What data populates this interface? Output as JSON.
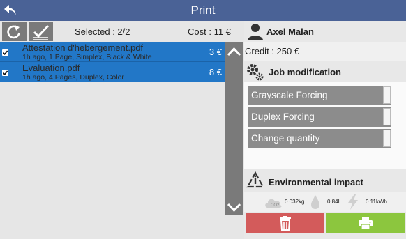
{
  "header": {
    "title": "Print",
    "back_icon": "back-arrow-icon"
  },
  "toolbar": {
    "refresh_icon": "refresh-icon",
    "select_all_icon": "select-all-checkmark-icon",
    "selected_label": "Selected : 2/2",
    "cost_label": "Cost : 11 €"
  },
  "jobs": [
    {
      "name": "Attestation d'hebergement.pdf",
      "meta": "1h ago, 1 Page, Simplex, Black & White",
      "price": "3 €",
      "checked": true
    },
    {
      "name": "Evaluation.pdf",
      "meta": "1h ago, 4 Pages, Duplex, Color",
      "price": "8 €",
      "checked": true
    }
  ],
  "user": {
    "name": "Axel Malan",
    "credit": "Credit : 250 €"
  },
  "job_modification": {
    "title": "Job modification",
    "options": [
      "Grayscale Forcing",
      "Duplex Forcing",
      "Change quantity"
    ]
  },
  "environment": {
    "title": "Environmental impact",
    "co2": "0.032kg",
    "water": "0.84L",
    "energy": "0.11kWh"
  },
  "colors": {
    "header": "#4a6296",
    "selected_row": "#2277c7",
    "delete": "#d35b5b",
    "print": "#8cc63e",
    "button_gray": "#8c8c8c"
  }
}
